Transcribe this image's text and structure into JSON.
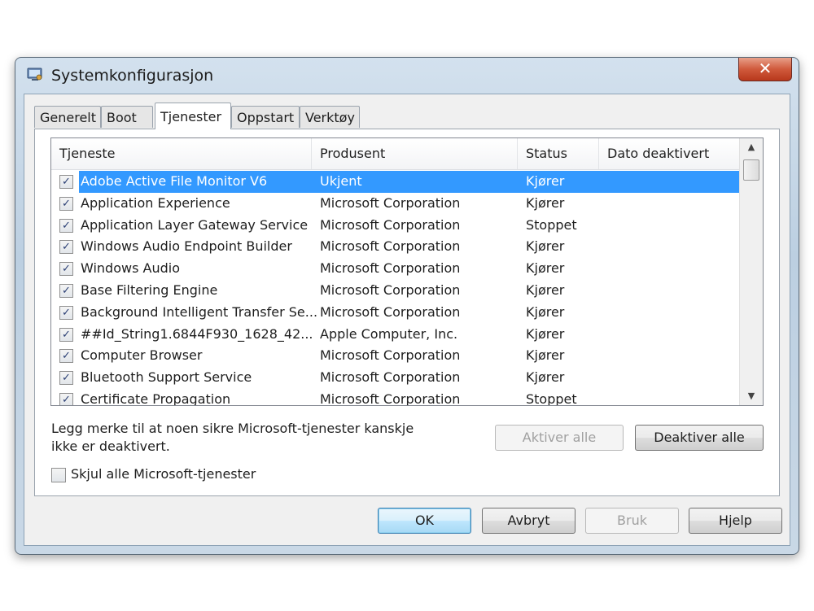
{
  "window": {
    "title": "Systemkonfigurasjon",
    "close_label": "✕"
  },
  "tabs": [
    {
      "label": "Generelt"
    },
    {
      "label": "Boot"
    },
    {
      "label": "Tjenester"
    },
    {
      "label": "Oppstart"
    },
    {
      "label": "Verktøy"
    }
  ],
  "columns": {
    "service": "Tjeneste",
    "vendor": "Produsent",
    "status": "Status",
    "date_disabled": "Dato deaktivert"
  },
  "services": [
    {
      "name": "Adobe Active File Monitor V6",
      "vendor": "Ukjent",
      "status": "Kjører",
      "checked": true,
      "selected": true
    },
    {
      "name": "Application Experience",
      "vendor": "Microsoft Corporation",
      "status": "Kjører",
      "checked": true
    },
    {
      "name": "Application Layer Gateway Service",
      "vendor": "Microsoft Corporation",
      "status": "Stoppet",
      "checked": true
    },
    {
      "name": "Windows Audio Endpoint Builder",
      "vendor": "Microsoft Corporation",
      "status": "Kjører",
      "checked": true
    },
    {
      "name": "Windows Audio",
      "vendor": "Microsoft Corporation",
      "status": "Kjører",
      "checked": true
    },
    {
      "name": "Base Filtering Engine",
      "vendor": "Microsoft Corporation",
      "status": "Kjører",
      "checked": true
    },
    {
      "name": "Background Intelligent Transfer Se...",
      "vendor": "Microsoft Corporation",
      "status": "Kjører",
      "checked": true
    },
    {
      "name": "##Id_String1.6844F930_1628_42...",
      "vendor": "Apple Computer, Inc.",
      "status": "Kjører",
      "checked": true
    },
    {
      "name": "Computer Browser",
      "vendor": "Microsoft Corporation",
      "status": "Kjører",
      "checked": true
    },
    {
      "name": "Bluetooth Support Service",
      "vendor": "Microsoft Corporation",
      "status": "Kjører",
      "checked": true
    },
    {
      "name": "Certificate Propagation",
      "vendor": "Microsoft Corporation",
      "status": "Stoppet",
      "checked": true
    }
  ],
  "note": "Legg merke til at noen sikre Microsoft-tjenester kanskje ikke er deaktivert.",
  "buttons": {
    "enable_all": "Aktiver alle",
    "disable_all": "Deaktiver alle",
    "ok": "OK",
    "cancel": "Avbryt",
    "apply": "Bruk",
    "help": "Hjelp"
  },
  "hide_ms_label": "Skjul alle Microsoft-tjenester",
  "hide_ms_checked": false,
  "colors": {
    "selection": "#3399ff",
    "title_bar": "#c9d8e6",
    "close_button": "#d05a3c"
  },
  "icons": {
    "app": "system-config-icon",
    "check": "✓",
    "scroll_up": "▲",
    "scroll_down": "▼"
  }
}
